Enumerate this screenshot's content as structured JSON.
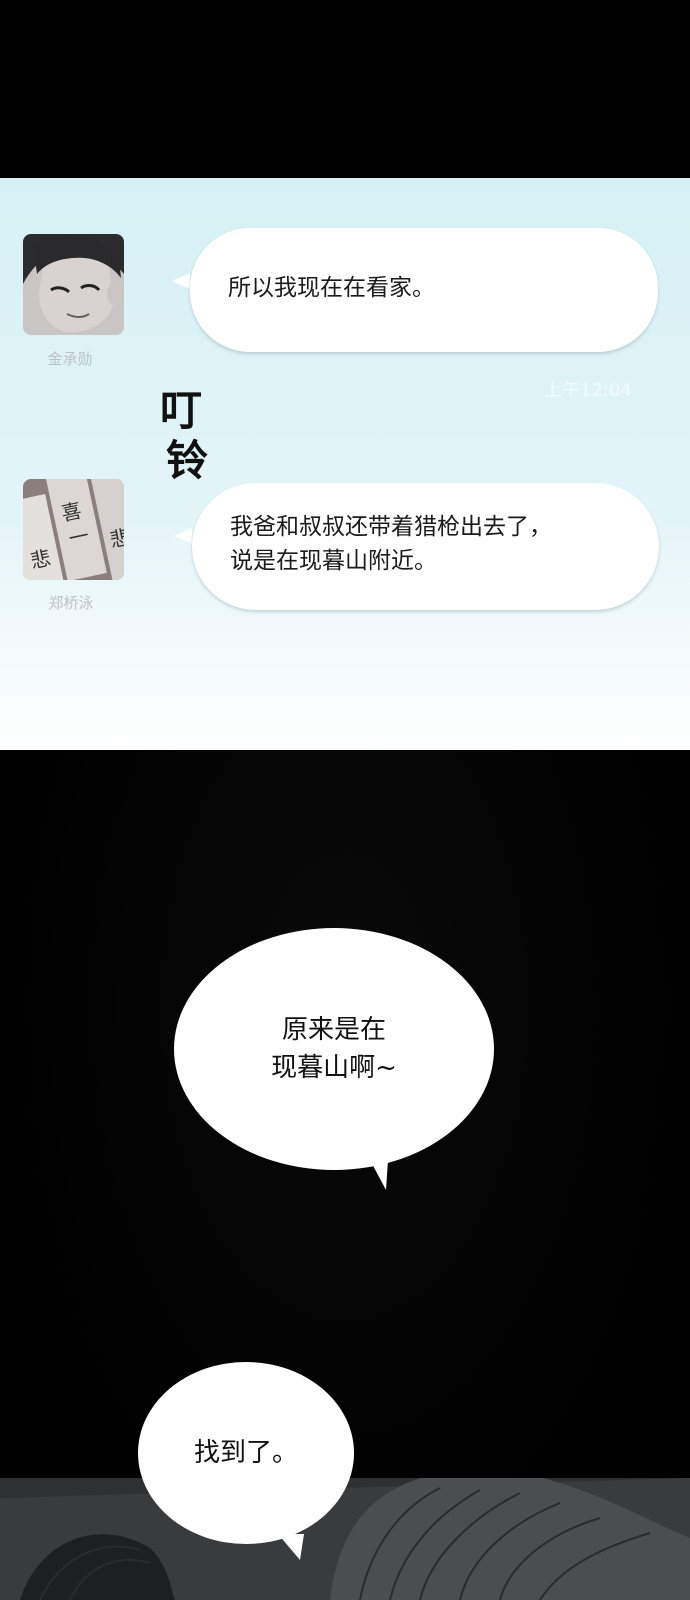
{
  "chat": {
    "message1": {
      "sender": "金承勋",
      "text": "所以我现在在看家。",
      "time": "上午12:04"
    },
    "sfx": [
      "叮",
      "铃"
    ],
    "message2": {
      "sender": "郑桥泳",
      "line1": "我爸和叔叔还带着猎枪出去了，",
      "line2": "说是在现暮山附近。"
    }
  },
  "speech": {
    "bubble1": {
      "line1": "原来是在",
      "line2": "现暮山啊~"
    },
    "bubble2": {
      "text": "找到了。"
    }
  },
  "colors": {
    "chat_bg_top": "#d6f1f4",
    "chat_bg_bottom": "#ffffff",
    "bubble": "#ffffff",
    "name_text": "#bcc2c6"
  }
}
